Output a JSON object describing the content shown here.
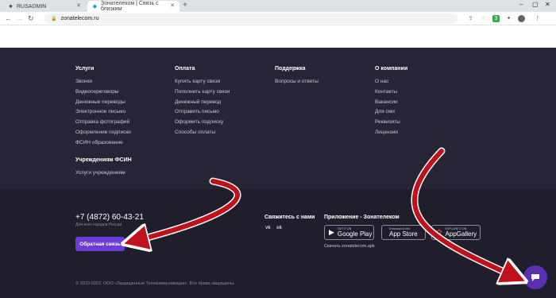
{
  "browser": {
    "tabs": [
      {
        "title": "RUSADMIN",
        "icon": "star-icon"
      },
      {
        "title": "Зонателеком | Связь с близким",
        "icon": "zonatelecom-favicon"
      }
    ],
    "url": "zonatelecom.ru",
    "ext_badge": "3"
  },
  "footer": {
    "columns": [
      {
        "title": "Услуги",
        "items": [
          "Звонки",
          "Видеопереговоры",
          "Денежные переводы",
          "Электронное письмо",
          "Отправка фотографий",
          "Оформление подписки",
          "ФСИН образование"
        ]
      },
      {
        "title": "Оплата",
        "items": [
          "Купить карту связи",
          "Пополнить карту связи",
          "Денежный перевод",
          "Отправить письмо",
          "Оформить подписку",
          "Способы оплаты"
        ]
      },
      {
        "title": "Поддержка",
        "items": [
          "Вопросы и ответы"
        ]
      },
      {
        "title": "О компании",
        "items": [
          "О нас",
          "Контакты",
          "Вакансии",
          "Для сми",
          "Реквизиты",
          "Лицензии"
        ]
      }
    ],
    "fsin": {
      "title": "Учреждениям ФСИН",
      "items": [
        "Услуги учреждениям"
      ]
    },
    "phone": "+7 (4872) 60-43-21",
    "phone_sub": "Для всех городов России",
    "feedback_button": "Обратная связь",
    "contact_title": "Свяжитесь с нами",
    "social": [
      "vk",
      "ok"
    ],
    "app_title": "Приложение - Зонателеком",
    "stores": [
      {
        "small": "GET IT ON",
        "big": "Google Play",
        "icon": "google-play-icon"
      },
      {
        "small": "Download on the",
        "big": "App Store",
        "icon": "apple-icon"
      },
      {
        "small": "EXPLORE IT ON",
        "big": "AppGallery",
        "icon": "huawei-icon"
      }
    ],
    "apk": "Скачать zonatelecom.apk",
    "copyright": "© 2010-2022, ООО «Защищенные Телекоммуникации». Все права защищены."
  },
  "colors": {
    "accent": "#6d3bd6",
    "arrow": "#c0101a",
    "footer": "#252536"
  }
}
